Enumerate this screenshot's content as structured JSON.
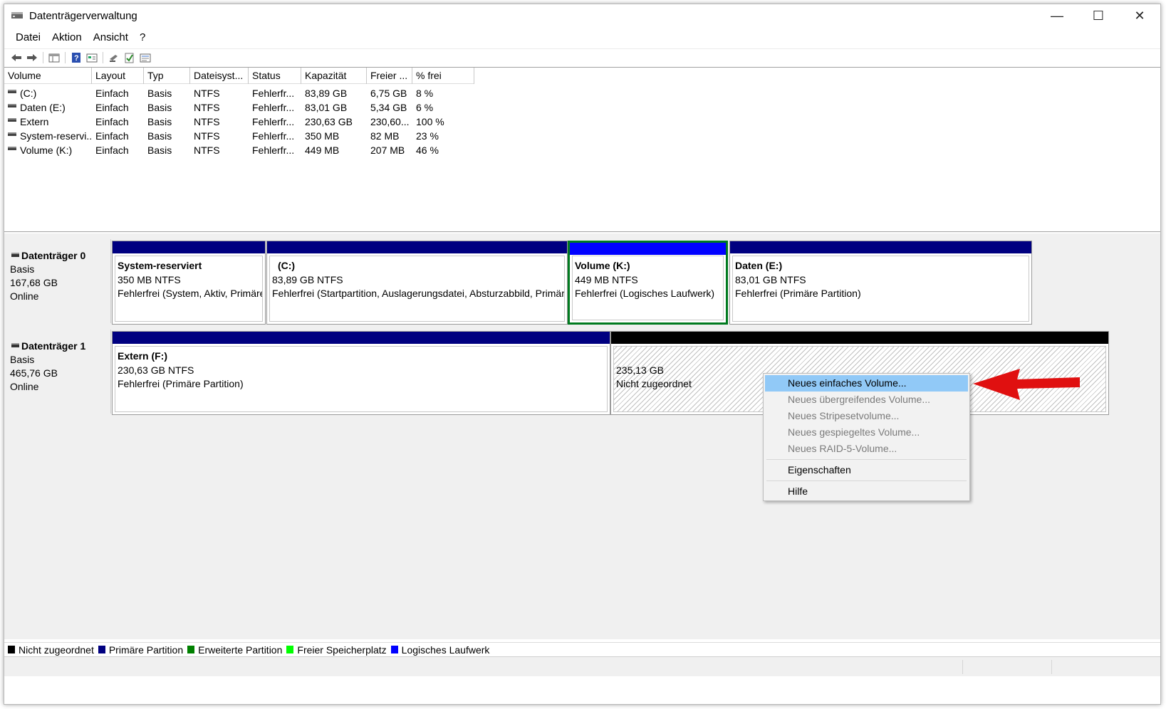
{
  "window": {
    "title": "Datenträgerverwaltung",
    "controls": [
      "—",
      "☐",
      "✕"
    ]
  },
  "menu": [
    "Datei",
    "Aktion",
    "Ansicht",
    "?"
  ],
  "toolbar": {
    "icons": [
      "back-arrow-icon",
      "forward-arrow-icon",
      "panel-icon",
      "help-icon",
      "view-icon",
      "key-icon",
      "check-icon",
      "list-icon"
    ]
  },
  "table": {
    "columns": [
      "Volume",
      "Layout",
      "Typ",
      "Dateisyst...",
      "Status",
      "Kapazität",
      "Freier ...",
      "% frei"
    ],
    "rows": [
      [
        "(C:)",
        "Einfach",
        "Basis",
        "NTFS",
        "Fehlerfr...",
        "83,89 GB",
        "6,75 GB",
        "8 %"
      ],
      [
        "Daten (E:)",
        "Einfach",
        "Basis",
        "NTFS",
        "Fehlerfr...",
        "83,01 GB",
        "5,34 GB",
        "6 %"
      ],
      [
        "Extern",
        "Einfach",
        "Basis",
        "NTFS",
        "Fehlerfr...",
        "230,63 GB",
        "230,60...",
        "100 %"
      ],
      [
        "System-reservi...",
        "Einfach",
        "Basis",
        "NTFS",
        "Fehlerfr...",
        "350 MB",
        "82 MB",
        "23 %"
      ],
      [
        "Volume (K:)",
        "Einfach",
        "Basis",
        "NTFS",
        "Fehlerfr...",
        "449 MB",
        "207 MB",
        "46 %"
      ]
    ]
  },
  "disks": [
    {
      "name": "Datenträger 0",
      "type": "Basis",
      "size": "167,68 GB",
      "state": "Online",
      "partitions": [
        {
          "name": "System-reserviert",
          "size": "350 MB NTFS",
          "status": "Fehlerfrei (System, Aktiv, Primäre Partition)",
          "color": "#000080"
        },
        {
          "name": "(C:)",
          "size": "83,89 GB NTFS",
          "status": "Fehlerfrei (Startpartition, Auslagerungsdatei, Absturzabbild, Primäre Partition)",
          "color": "#000080"
        },
        {
          "name": "Volume  (K:)",
          "size": "449 MB NTFS",
          "status": "Fehlerfrei (Logisches Laufwerk)",
          "color": "#0000ff"
        },
        {
          "name": "Daten  (E:)",
          "size": "83,01 GB NTFS",
          "status": "Fehlerfrei (Primäre Partition)",
          "color": "#000080"
        }
      ]
    },
    {
      "name": "Datenträger 1",
      "type": "Basis",
      "size": "465,76 GB",
      "state": "Online",
      "partitions": [
        {
          "name": "Extern  (F:)",
          "size": "230,63 GB NTFS",
          "status": "Fehlerfrei (Primäre Partition)",
          "color": "#000080"
        },
        {
          "name": "",
          "size": "235,13 GB",
          "status": "Nicht zugeordnet",
          "color": "#000000"
        }
      ]
    }
  ],
  "context_menu": {
    "items": [
      {
        "label": "Neues einfaches Volume...",
        "state": "highlighted"
      },
      {
        "label": "Neues übergreifendes Volume...",
        "state": "disabled"
      },
      {
        "label": "Neues Stripesetvolume...",
        "state": "disabled"
      },
      {
        "label": "Neues gespiegeltes Volume...",
        "state": "disabled"
      },
      {
        "label": "Neues RAID-5-Volume...",
        "state": "disabled"
      },
      {
        "label": "Eigenschaften",
        "state": "enabled"
      },
      {
        "label": "Hilfe",
        "state": "enabled"
      }
    ]
  },
  "legend": [
    {
      "label": "Nicht zugeordnet",
      "color": "#000000"
    },
    {
      "label": "Primäre Partition",
      "color": "#000080"
    },
    {
      "label": "Erweiterte Partition",
      "color": "#008000"
    },
    {
      "label": "Freier Speicherplatz",
      "color": "#00ff00"
    },
    {
      "label": "Logisches Laufwerk",
      "color": "#0000ff"
    }
  ],
  "colors": {
    "selection_border": "#007a1f",
    "highlight": "#91c9f7",
    "annotation_arrow": "#e01010"
  }
}
